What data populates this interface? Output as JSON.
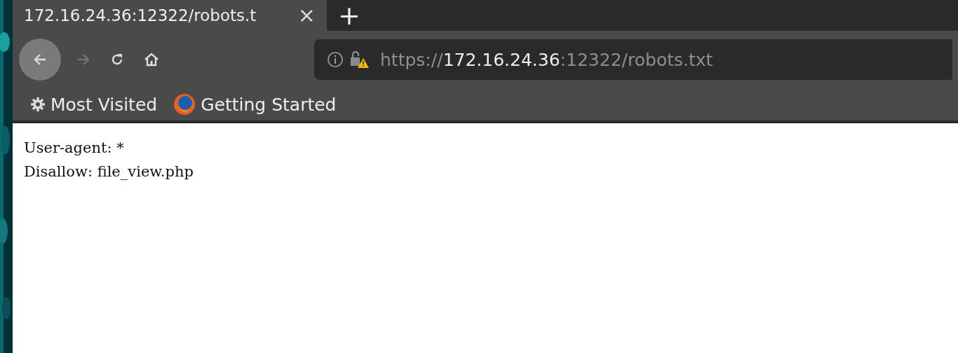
{
  "tabs": [
    {
      "title": "172.16.24.36:12322/robots.t",
      "selected": true
    }
  ],
  "new_tab": "+",
  "close_tab": "×",
  "nav": {
    "back_enabled": true,
    "forward_enabled": false
  },
  "url": {
    "scheme": "https://",
    "host": "172.16.24.36",
    "rest": ":12322/robots.txt",
    "insecure": true
  },
  "bookmarks": [
    {
      "kind": "folder",
      "label": "Most Visited"
    },
    {
      "kind": "site",
      "label": "Getting Started"
    }
  ],
  "content": {
    "lines": [
      "User-agent: *",
      "Disallow: file_view.php"
    ]
  }
}
